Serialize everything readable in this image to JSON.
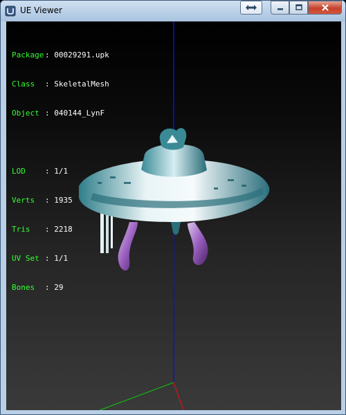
{
  "window": {
    "title": "UE Viewer"
  },
  "info": {
    "header_rows": [
      {
        "label": "Package",
        "value": "00029291.upk"
      },
      {
        "label": "Class",
        "value": "SkeletalMesh"
      },
      {
        "label": "Object",
        "value": "040144_LynF"
      }
    ],
    "stat_rows": [
      {
        "label": "LOD",
        "value": "1/1"
      },
      {
        "label": "Verts",
        "value": "1935"
      },
      {
        "label": "Tris",
        "value": "2218"
      },
      {
        "label": "UV Set",
        "value": "1/1"
      },
      {
        "label": "Bones",
        "value": "29"
      }
    ],
    "separator": ":"
  },
  "colors": {
    "label_green": "#33ff33",
    "value_white": "#ffffff",
    "axis_x_red": "#e01010",
    "axis_y_green": "#10c010",
    "axis_z_blue": "#1010d0"
  },
  "icons": {
    "app": "ue-viewer-icon",
    "fullscreen": "fullscreen-arrows-icon",
    "minimize": "minimize-icon",
    "maximize": "maximize-icon",
    "close": "close-icon"
  }
}
